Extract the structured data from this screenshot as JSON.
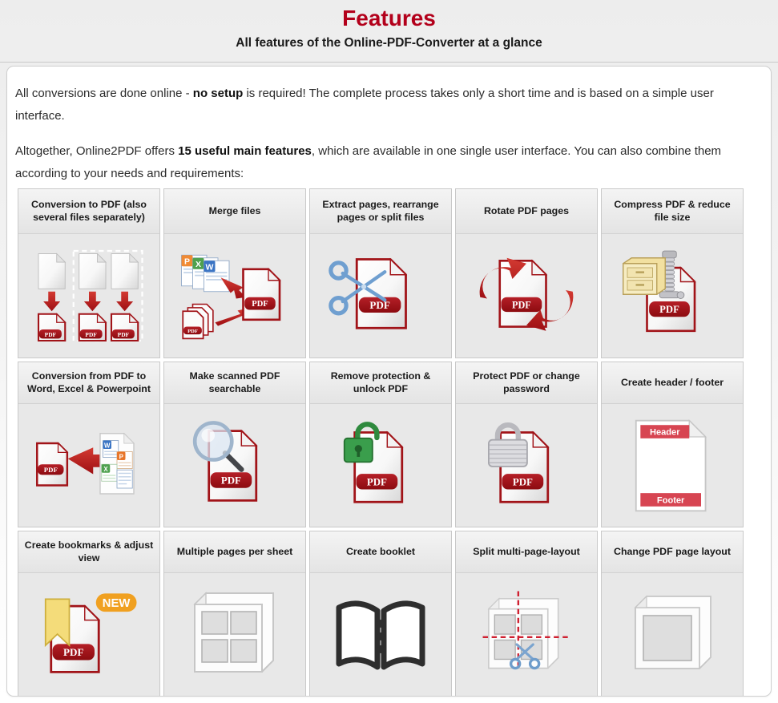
{
  "header": {
    "title": "Features",
    "subtitle": "All features of the Online-PDF-Converter at a glance",
    "title_color": "#b3001b"
  },
  "intro": {
    "paragraph1_part1": "All conversions are done online - ",
    "paragraph1_bold": "no setup",
    "paragraph1_part2": " is required! The complete process takes only a short time and is based on a simple user interface.",
    "paragraph2_part1": "Altogether, Online2PDF offers ",
    "paragraph2_bold": "15 useful main features",
    "paragraph2_part2": ", which are available in one single user interface. You can also combine them according to your needs and requirements:"
  },
  "badges": {
    "new": "NEW",
    "new_color": "#f0a020"
  },
  "doc_labels": {
    "pdf": "PDF",
    "header": "Header",
    "footer": "Footer",
    "word": "W",
    "excel": "X",
    "powerpoint": "P"
  },
  "features": [
    [
      {
        "title": "Conversion to PDF (also several files separately)",
        "icon": "conversion-to-pdf-icon"
      },
      {
        "title": "Merge files",
        "icon": "merge-files-icon"
      },
      {
        "title": "Extract pages, rearrange pages or split files",
        "icon": "scissors-pdf-icon"
      },
      {
        "title": "Rotate PDF pages",
        "icon": "rotate-pdf-icon"
      },
      {
        "title": "Compress PDF & reduce file size",
        "icon": "compress-pdf-icon"
      }
    ],
    [
      {
        "title": "Conversion from PDF to Word, Excel & Powerpoint",
        "icon": "pdf-to-office-icon"
      },
      {
        "title": "Make scanned PDF searchable",
        "icon": "magnifier-pdf-icon"
      },
      {
        "title": "Remove protection & unlock PDF",
        "icon": "unlock-pdf-icon"
      },
      {
        "title": "Protect PDF or change password",
        "icon": "lock-pdf-icon"
      },
      {
        "title": "Create header / footer",
        "icon": "header-footer-icon"
      }
    ],
    [
      {
        "title": "Create bookmarks & adjust view",
        "icon": "bookmark-pdf-icon",
        "badge": "NEW"
      },
      {
        "title": "Multiple pages per sheet",
        "icon": "multiple-pages-icon"
      },
      {
        "title": "Create booklet",
        "icon": "booklet-icon"
      },
      {
        "title": "Split multi-page-layout",
        "icon": "split-layout-icon"
      },
      {
        "title": "Change PDF page layout",
        "icon": "page-layout-icon"
      }
    ]
  ]
}
